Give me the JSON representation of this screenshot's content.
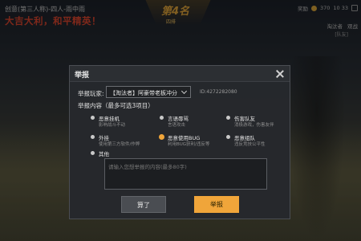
{
  "hud": {
    "mode": "创意(第三人称)-四人-雨中雨",
    "slogan": "大吉大利，和平精英！",
    "rank": "第4名",
    "rank_sub": "四排",
    "coins_label": "奖励",
    "coins": "370",
    "rank_right": "10  33",
    "player_name": "淘汰者",
    "spectate": "观战",
    "teammates": "[队友]"
  },
  "dialog": {
    "title": "举报",
    "player_label": "举报玩家:",
    "player_value": "【淘汰者】阿豪带老板冲分",
    "player_id": "ID:4272282080",
    "content_label": "举报内容（最多可选3项目）",
    "options": [
      {
        "title": "恶意挂机",
        "desc": "影响战斗不动",
        "selected": false
      },
      {
        "title": "言语辱骂",
        "desc": "言语攻击",
        "selected": false
      },
      {
        "title": "伤害队友",
        "desc": "消极游戏，伤害友伴",
        "selected": false
      },
      {
        "title": "外挂",
        "desc": "使用第三方软件/作弊",
        "selected": false
      },
      {
        "title": "恶意使用BUG",
        "desc": "利用BUG获利/违反等",
        "selected": true
      },
      {
        "title": "恶意组队",
        "desc": "违反竞技公平性",
        "selected": false
      },
      {
        "title": "其他",
        "desc": "",
        "selected": false
      }
    ],
    "textarea_placeholder": "请输入您想举报的内容(最多80字)",
    "cancel_label": "算了",
    "submit_label": "举报"
  },
  "colors": {
    "accent": "#f0a53a",
    "slogan": "#d9452e",
    "panel": "#26282c"
  }
}
